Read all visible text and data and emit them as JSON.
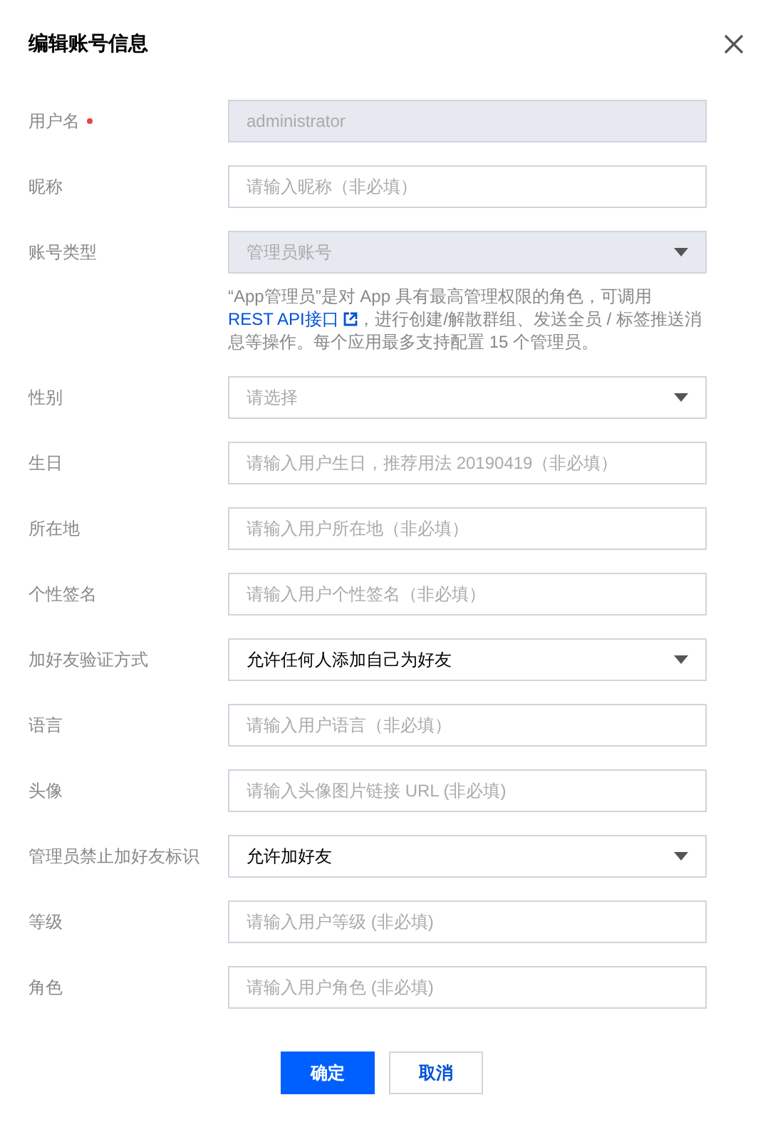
{
  "dialog": {
    "title": "编辑账号信息"
  },
  "fields": [
    {
      "label": "用户名",
      "required": true,
      "kind": "text",
      "value": "administrator",
      "disabled": true
    },
    {
      "label": "昵称",
      "required": false,
      "kind": "text",
      "placeholder": "请输入昵称（非必填）",
      "disabled": false
    },
    {
      "label": "账号类型",
      "required": false,
      "kind": "select",
      "value": "管理员账号",
      "disabled": true,
      "help": {
        "before": "“App管理员”是对 App 具有最高管理权限的角色，可调用",
        "link": "REST API接口",
        "after": "，进行创建/解散群组、发送全员 / 标签推送消息等操作。每个应用最多支持配置 15 个管理员。"
      }
    },
    {
      "label": "性别",
      "required": false,
      "kind": "select",
      "placeholder": "请选择",
      "disabled": false
    },
    {
      "label": "生日",
      "required": false,
      "kind": "text",
      "placeholder": "请输入用户生日，推荐用法 20190419（非必填）",
      "disabled": false
    },
    {
      "label": "所在地",
      "required": false,
      "kind": "text",
      "placeholder": "请输入用户所在地（非必填）",
      "disabled": false
    },
    {
      "label": "个性签名",
      "required": false,
      "kind": "text",
      "placeholder": "请输入用户个性签名（非必填）",
      "disabled": false
    },
    {
      "label": "加好友验证方式",
      "required": false,
      "kind": "select",
      "value": "允许任何人添加自己为好友",
      "disabled": false
    },
    {
      "label": "语言",
      "required": false,
      "kind": "text",
      "placeholder": "请输入用户语言（非必填）",
      "disabled": false
    },
    {
      "label": "头像",
      "required": false,
      "kind": "text",
      "placeholder": "请输入头像图片链接 URL (非必填)",
      "disabled": false
    },
    {
      "label": "管理员禁止加好友标识",
      "required": false,
      "kind": "select",
      "value": "允许加好友",
      "disabled": false
    },
    {
      "label": "等级",
      "required": false,
      "kind": "text",
      "placeholder": "请输入用户等级 (非必填)",
      "disabled": false
    },
    {
      "label": "角色",
      "required": false,
      "kind": "text",
      "placeholder": "请输入用户角色 (非必填)",
      "disabled": false
    }
  ],
  "buttons": [
    {
      "label": "确定",
      "kind": "primary"
    },
    {
      "label": "取消",
      "kind": "secondary"
    }
  ]
}
